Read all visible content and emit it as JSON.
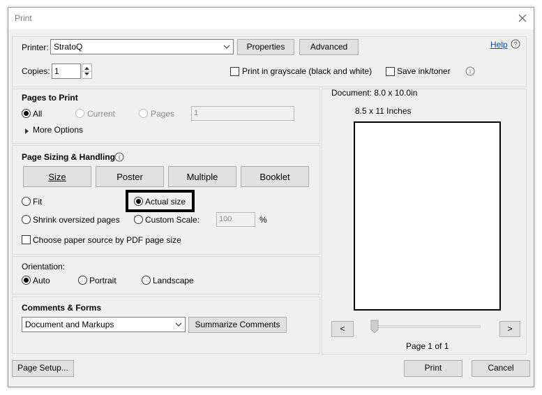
{
  "window": {
    "title": "Print"
  },
  "printer": {
    "label": "Printer:",
    "selected": "StratoQ",
    "properties_label": "Properties",
    "advanced_label": "Advanced",
    "help_label": "Help"
  },
  "copies": {
    "label": "Copies:",
    "value": "1"
  },
  "options": {
    "grayscale_label": "Print in grayscale (black and white)",
    "save_ink_label": "Save ink/toner"
  },
  "pages_to_print": {
    "heading": "Pages to Print",
    "all_label": "All",
    "current_label": "Current",
    "pages_label": "Pages",
    "pages_value": "1",
    "more_options_label": "More Options"
  },
  "sizing": {
    "heading": "Page Sizing & Handling",
    "tabs": [
      "Size",
      "Poster",
      "Multiple",
      "Booklet"
    ],
    "fit_label": "Fit",
    "actual_size_label": "Actual size",
    "shrink_label": "Shrink oversized pages",
    "custom_scale_label": "Custom Scale:",
    "custom_scale_value": "100",
    "percent_sign": "%",
    "paper_source_label": "Choose paper source by PDF page size"
  },
  "orientation": {
    "heading": "Orientation:",
    "auto_label": "Auto",
    "portrait_label": "Portrait",
    "landscape_label": "Landscape"
  },
  "comments": {
    "heading": "Comments & Forms",
    "selected": "Document and Markups",
    "summarize_label": "Summarize Comments"
  },
  "preview": {
    "document_size": "Document: 8.0 x 10.0in",
    "paper_size": "8.5 x 11 Inches",
    "prev_label": "<",
    "next_label": ">",
    "page_indicator": "Page 1 of 1"
  },
  "footer": {
    "page_setup_label": "Page Setup...",
    "print_label": "Print",
    "cancel_label": "Cancel"
  },
  "colors": {
    "link": "#0645ad",
    "highlight_border": "#000000"
  }
}
